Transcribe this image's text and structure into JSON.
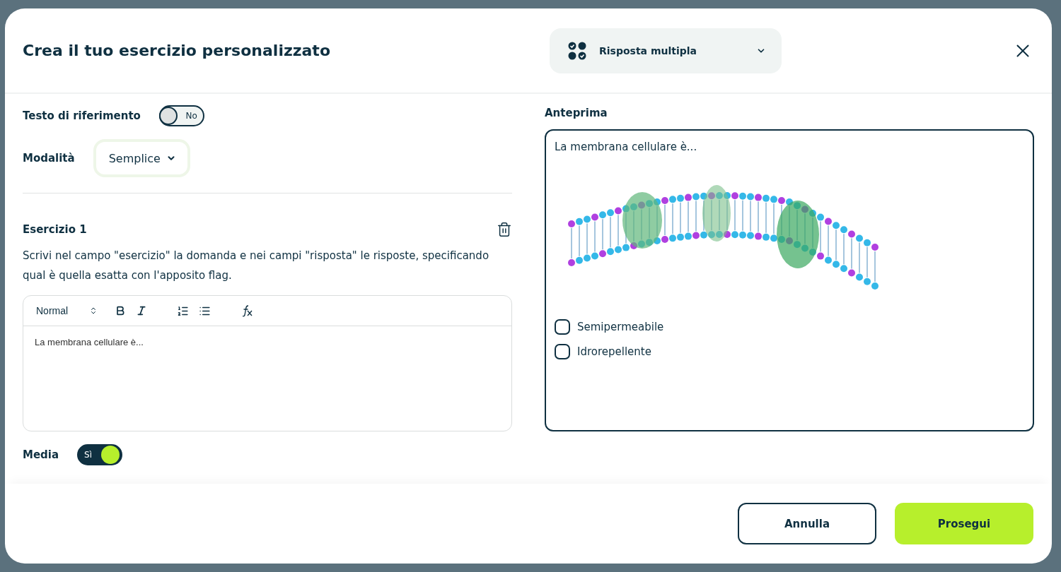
{
  "dialog": {
    "title": "Crea il tuo esercizio personalizzato",
    "type_select": {
      "value": "Risposta multipla"
    }
  },
  "settings": {
    "reference_text": {
      "label": "Testo di riferimento",
      "on": false,
      "state_text": "No"
    },
    "mode": {
      "label": "Modalità",
      "value": "Semplice"
    }
  },
  "exercise": {
    "title": "Esercizio 1",
    "instructions": "Scrivi nel campo \"esercizio\" la domanda e nei campi \"risposta\" le risposte, specificando qual è quella esatta con l'apposito flag.",
    "editor": {
      "format": "Normal",
      "value": "La membrana cellulare è..."
    }
  },
  "media": {
    "label": "Media",
    "on": true,
    "state_text": "Sì"
  },
  "preview": {
    "title": "Anteprima",
    "question": "La membrana cellulare è...",
    "answers": [
      {
        "label": "Semipermeabile",
        "checked": false
      },
      {
        "label": "Idrorepellente",
        "checked": false
      }
    ]
  },
  "buttons": [
    {
      "label": "Annulla",
      "kind": "secondary"
    },
    {
      "label": "Prosegui",
      "kind": "primary"
    }
  ]
}
